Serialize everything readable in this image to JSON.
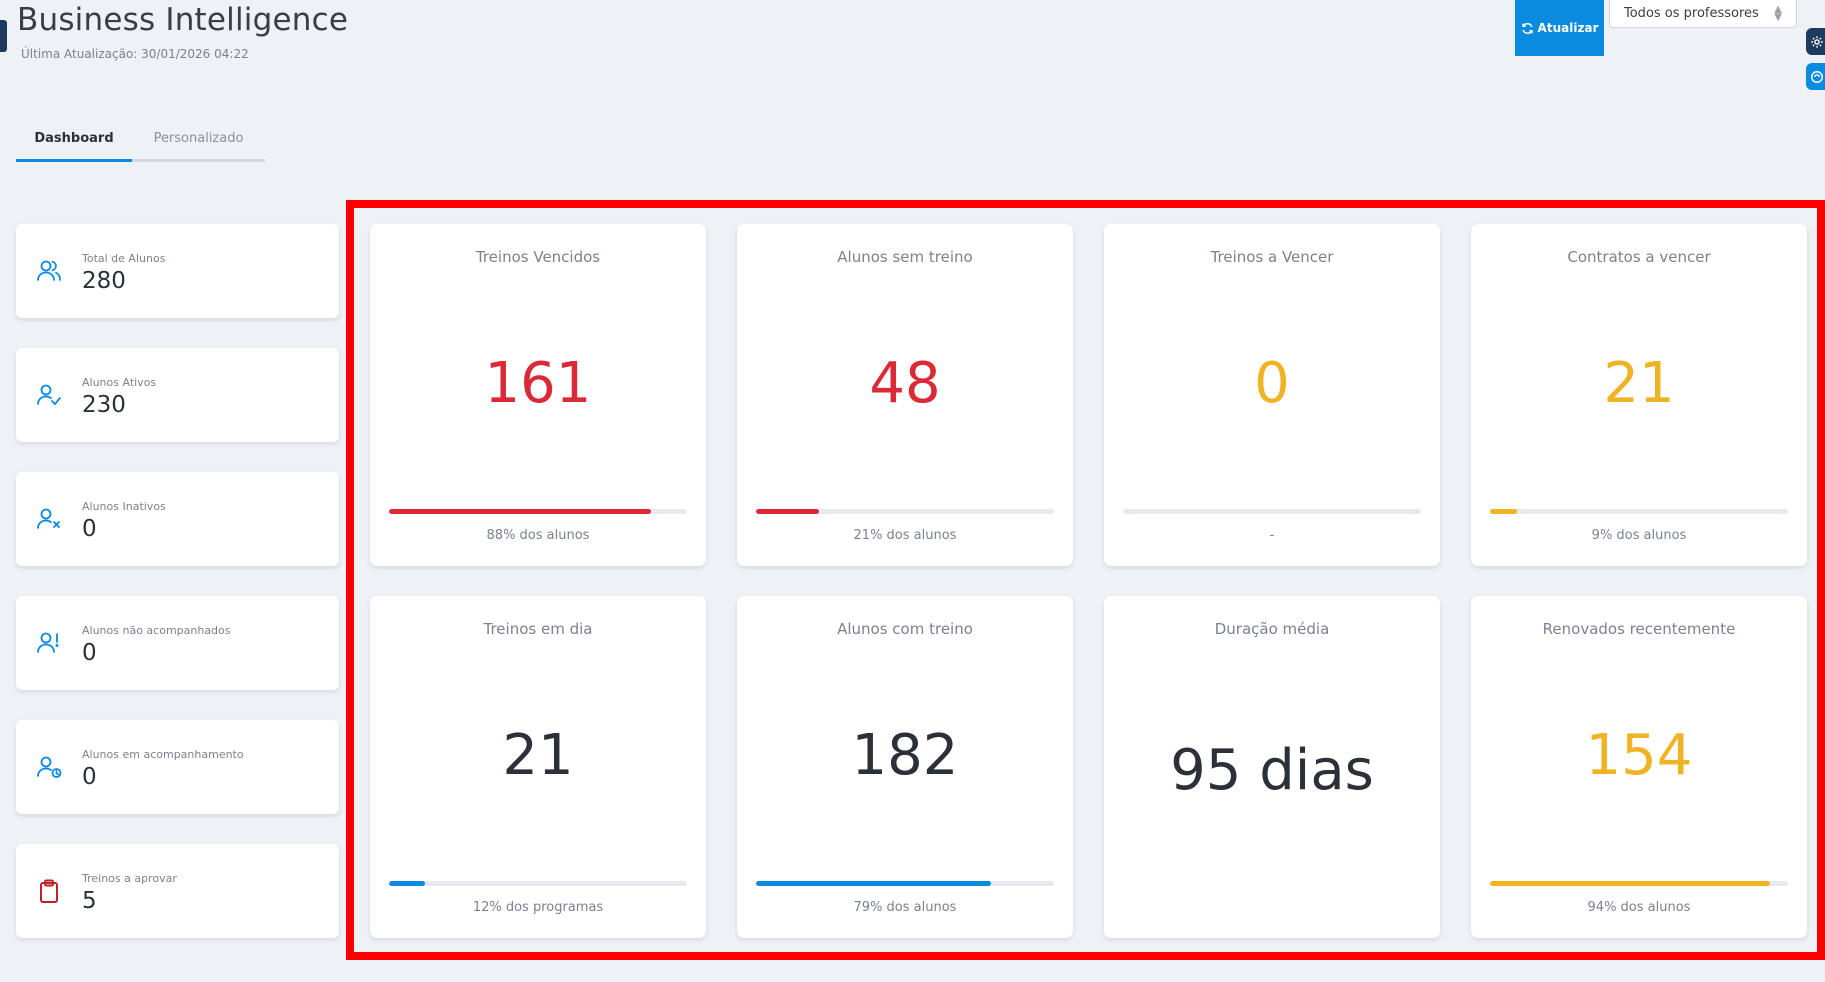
{
  "header": {
    "title": "Business Intelligence",
    "last_update": "Última Atualização: 30/01/2026 04:22",
    "refresh_label": "Atualizar",
    "professor_select": "Todos os professores"
  },
  "tabs": [
    {
      "label": "Dashboard",
      "active": true
    },
    {
      "label": "Personalizado",
      "active": false
    }
  ],
  "stats": [
    {
      "label": "Total de Alunos",
      "value": "280",
      "icon": "users-icon",
      "color": "#0a8bdf"
    },
    {
      "label": "Alunos Ativos",
      "value": "230",
      "icon": "user-check-icon",
      "color": "#0a8bdf"
    },
    {
      "label": "Alunos Inativos",
      "value": "0",
      "icon": "user-x-icon",
      "color": "#0a8bdf"
    },
    {
      "label": "Alunos não acompanhados",
      "value": "0",
      "icon": "user-alert-icon",
      "color": "#0a8bdf"
    },
    {
      "label": "Alunos em acompanhamento",
      "value": "0",
      "icon": "user-clock-icon",
      "color": "#0a8bdf"
    },
    {
      "label": "Treinos a aprovar",
      "value": "5",
      "icon": "clipboard-icon",
      "color": "#c0202a"
    }
  ],
  "metrics": [
    {
      "title": "Treinos Vencidos",
      "value": "161",
      "color": "#db2a36",
      "progress": 0.88,
      "bar_color": "#db2a36",
      "subtitle": "88% dos alunos"
    },
    {
      "title": "Alunos sem treino",
      "value": "48",
      "color": "#db2a36",
      "progress": 0.21,
      "bar_color": "#db2a36",
      "subtitle": "21% dos alunos"
    },
    {
      "title": "Treinos a Vencer",
      "value": "0",
      "color": "#f0b323",
      "progress": 0,
      "bar_color": "#f0b323",
      "subtitle": "-"
    },
    {
      "title": "Contratos a vencer",
      "value": "21",
      "color": "#f0b323",
      "progress": 0.09,
      "bar_color": "#f0b323",
      "subtitle": "9% dos alunos"
    },
    {
      "title": "Treinos em dia",
      "value": "21",
      "color": "#2c3038",
      "progress": 0.12,
      "bar_color": "#0a8bdf",
      "subtitle": "12% dos programas"
    },
    {
      "title": "Alunos com treino",
      "value": "182",
      "color": "#2c3038",
      "progress": 0.79,
      "bar_color": "#0a8bdf",
      "subtitle": "79% dos alunos"
    },
    {
      "title": "Duração média",
      "value": "95 dias",
      "color": "#2c3038",
      "progress": null,
      "bar_color": "",
      "subtitle": ""
    },
    {
      "title": "Renovados recentemente",
      "value": "154",
      "color": "#f0b323",
      "progress": 0.94,
      "bar_color": "#f0b323",
      "subtitle": "94% dos alunos"
    }
  ]
}
